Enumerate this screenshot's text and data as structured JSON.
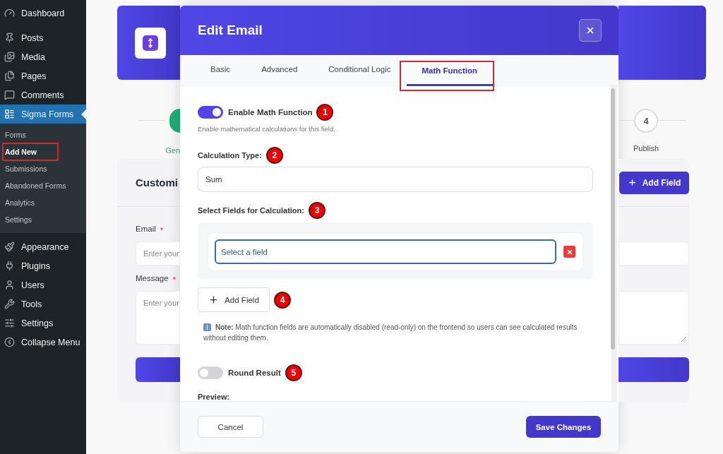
{
  "sidebar": {
    "menu": [
      {
        "label": "Dashboard",
        "selected": false
      },
      {
        "label": "Posts",
        "selected": false
      },
      {
        "label": "Media",
        "selected": false
      },
      {
        "label": "Pages",
        "selected": false
      },
      {
        "label": "Comments",
        "selected": false
      },
      {
        "label": "Sigma Forms",
        "selected": true,
        "children": [
          {
            "label": "Forms",
            "selected": false,
            "highlighted": false
          },
          {
            "label": "Add New",
            "selected": true,
            "highlighted": true
          },
          {
            "label": "Submissions",
            "selected": false,
            "highlighted": false
          },
          {
            "label": "Abandoned Forms",
            "selected": false,
            "highlighted": false
          },
          {
            "label": "Analytics",
            "selected": false,
            "highlighted": false
          },
          {
            "label": "Settings",
            "selected": false,
            "highlighted": false
          }
        ]
      },
      {
        "label": "Appearance",
        "selected": false
      },
      {
        "label": "Plugins",
        "selected": false
      },
      {
        "label": "Users",
        "selected": false
      },
      {
        "label": "Tools",
        "selected": false
      },
      {
        "label": "Settings",
        "selected": false
      }
    ],
    "collapse": "Collapse Menu"
  },
  "page": {
    "steps": [
      {
        "label": "Gen",
        "completed": true
      },
      {
        "number": "4",
        "label": "Publish",
        "completed": false
      }
    ],
    "form_card": {
      "title": "Customi",
      "add_button": "Add Field",
      "fields": [
        {
          "kind": "input",
          "label": "Email",
          "required_mark": "*",
          "placeholder": "Enter your"
        },
        {
          "kind": "textarea",
          "label": "Message",
          "required_mark": "*",
          "placeholder": "Enter your"
        }
      ]
    }
  },
  "modal": {
    "title": "Edit Email",
    "tabs": [
      {
        "label": "Basic",
        "selected": false,
        "highlighted": false
      },
      {
        "label": "Advanced",
        "selected": false,
        "highlighted": false
      },
      {
        "label": "Conditional Logic",
        "selected": false,
        "highlighted": false
      },
      {
        "label": "Math Function",
        "selected": true,
        "highlighted": true
      }
    ],
    "enable_toggle": {
      "label": "Enable Math Function",
      "on": true,
      "annotation": "1"
    },
    "enable_hint": "Enable mathematical calculations for this field.",
    "calculation_type": {
      "label": "Calculation Type:",
      "value": "Sum",
      "annotation": "2"
    },
    "select_fields": {
      "label": "Select Fields for Calculation:",
      "annotation": "3",
      "fields": [
        {
          "value": "Select a field"
        }
      ]
    },
    "add_field": {
      "label": "Add Field",
      "annotation": "4"
    },
    "note": "**Note:** Math function fields are automatically disabled (read-only) on the frontend so users can see calculated results without editing them.",
    "round_toggle": {
      "label": "Round Result",
      "on": false,
      "annotation": "5"
    },
    "preview_label": "Preview:",
    "buttons": {
      "cancel": "Cancel",
      "save": "Save Changes"
    }
  }
}
